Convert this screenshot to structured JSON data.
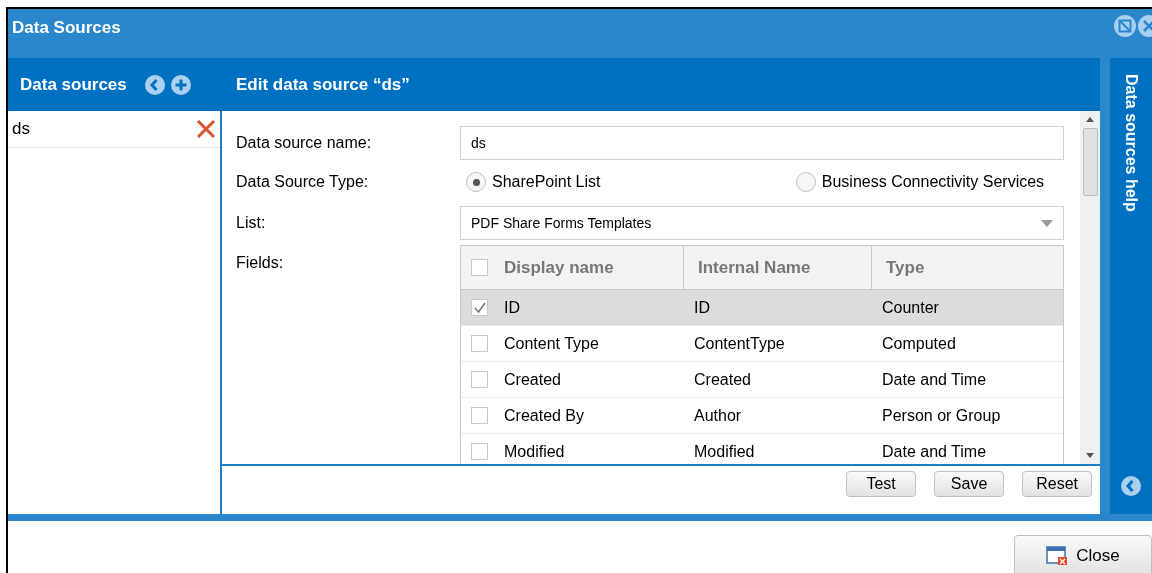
{
  "window": {
    "title": "Data Sources"
  },
  "sidebar": {
    "title": "Data sources",
    "items": [
      {
        "label": "ds",
        "selected": false
      }
    ]
  },
  "editor": {
    "title": "Edit data source “ds”",
    "name_field": {
      "label": "Data source name:",
      "value": "ds"
    },
    "type_field": {
      "label": "Data Source Type:",
      "options": [
        {
          "label": "SharePoint List",
          "selected": true
        },
        {
          "label": "Business Connectivity Services",
          "selected": false
        }
      ]
    },
    "list_field": {
      "label": "List:",
      "value": "PDF Share Forms Templates"
    },
    "fields": {
      "label": "Fields:",
      "all_checked": false,
      "columns": [
        "Display name",
        "Internal Name",
        "Type"
      ],
      "rows": [
        {
          "cells": [
            "ID",
            "ID",
            "Counter"
          ],
          "checked": true,
          "selected": true
        },
        {
          "cells": [
            "Content Type",
            "ContentType",
            "Computed"
          ],
          "checked": false,
          "selected": false
        },
        {
          "cells": [
            "Created",
            "Created",
            "Date and Time"
          ],
          "checked": false,
          "selected": false
        },
        {
          "cells": [
            "Created By",
            "Author",
            "Person or Group"
          ],
          "checked": false,
          "selected": false
        },
        {
          "cells": [
            "Modified",
            "Modified",
            "Date and Time"
          ],
          "checked": false,
          "selected": false
        }
      ]
    },
    "buttons": [
      "Test",
      "Save",
      "Reset"
    ]
  },
  "help_panel": {
    "title": "Data sources help"
  },
  "footer": {
    "buttons": [
      "Close"
    ]
  }
}
